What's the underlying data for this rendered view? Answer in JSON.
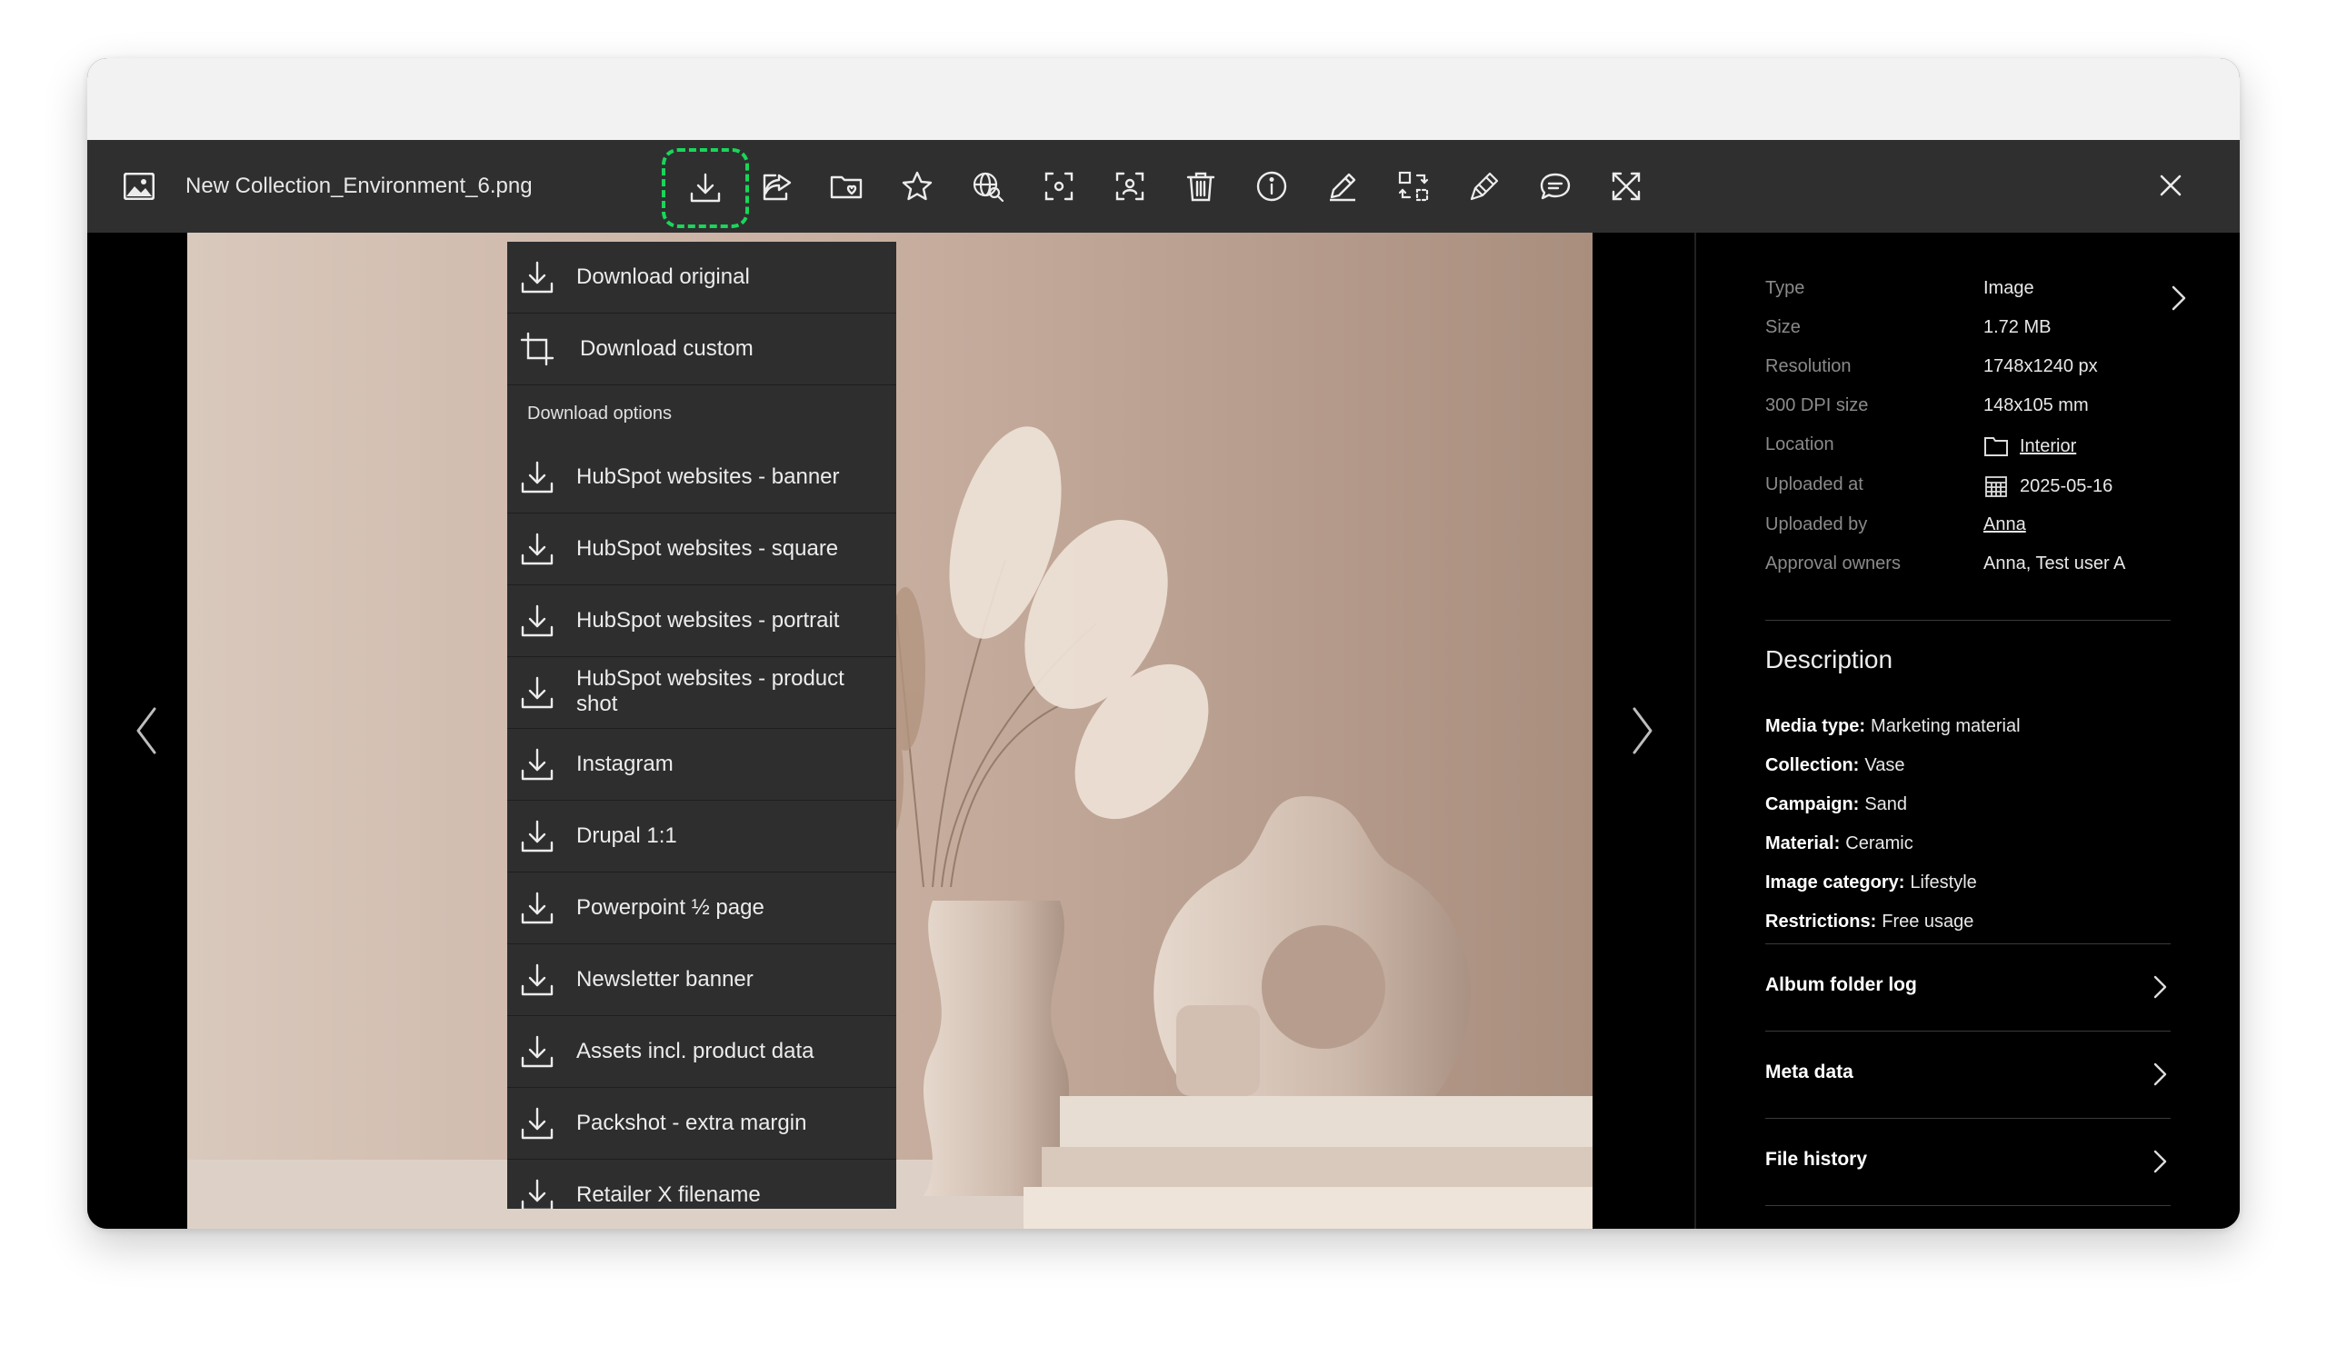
{
  "file": {
    "name": "New Collection_Environment_6.png"
  },
  "dropdown": {
    "top_items": [
      {
        "label": "Download original",
        "icon": "download-icon"
      },
      {
        "label": "Download custom",
        "icon": "crop-icon"
      }
    ],
    "section_label": "Download options",
    "options": [
      {
        "label": "HubSpot websites - banner"
      },
      {
        "label": "HubSpot websites - square"
      },
      {
        "label": "HubSpot websites - portrait"
      },
      {
        "label": "HubSpot websites - product shot"
      },
      {
        "label": "Instagram"
      },
      {
        "label": "Drupal 1:1"
      },
      {
        "label": "Powerpoint ½ page"
      },
      {
        "label": "Newsletter banner"
      },
      {
        "label": "Assets incl. product data"
      },
      {
        "label": "Packshot - extra margin"
      },
      {
        "label": "Retailer X filename"
      }
    ]
  },
  "meta": {
    "type": {
      "label": "Type",
      "value": "Image"
    },
    "size": {
      "label": "Size",
      "value": "1.72 MB"
    },
    "resolution": {
      "label": "Resolution",
      "value": "1748x1240 px"
    },
    "dpi": {
      "label": "300 DPI size",
      "value": "148x105 mm"
    },
    "location": {
      "label": "Location",
      "value": "Interior"
    },
    "uploaded_at": {
      "label": "Uploaded at",
      "value": "2025-05-16"
    },
    "uploaded_by": {
      "label": "Uploaded by",
      "value": "Anna"
    },
    "approval": {
      "label": "Approval owners",
      "value": "Anna, Test user A"
    }
  },
  "description": {
    "title": "Description",
    "fields": [
      {
        "key": "Media type:",
        "value": "Marketing material"
      },
      {
        "key": "Collection:",
        "value": "Vase"
      },
      {
        "key": "Campaign:",
        "value": "Sand"
      },
      {
        "key": "Material:",
        "value": "Ceramic"
      },
      {
        "key": "Image category:",
        "value": "Lifestyle"
      },
      {
        "key": "Restrictions:",
        "value": "Free usage"
      }
    ]
  },
  "accordions": [
    {
      "label": "Album folder log"
    },
    {
      "label": "Meta data"
    },
    {
      "label": "File history"
    }
  ],
  "colors": {
    "highlight": "#19d65a",
    "toolbar": "#2f2f2f",
    "menu": "#2e2e2e"
  }
}
